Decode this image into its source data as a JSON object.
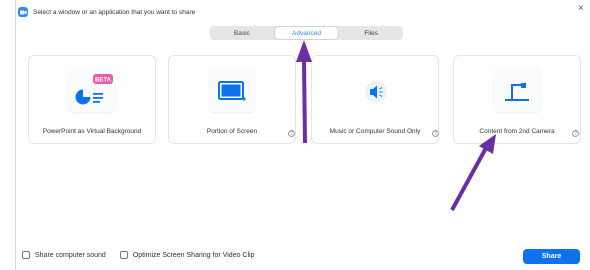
{
  "window": {
    "title": "Select a window or an application that you want to share",
    "close_glyph": "×"
  },
  "tabs": [
    {
      "label": "Basic",
      "active": false
    },
    {
      "label": "Advanced",
      "active": true
    },
    {
      "label": "Files",
      "active": false
    }
  ],
  "cards": [
    {
      "label": "PowerPoint as Virtual Background",
      "badge": "BETA",
      "icon": "powerpoint-icon",
      "has_help": false
    },
    {
      "label": "Portion of Screen",
      "icon": "screen-portion-icon",
      "has_help": true
    },
    {
      "label": "Music or Computer Sound Only",
      "icon": "speaker-icon",
      "has_help": true
    },
    {
      "label": "Content from 2nd Camera",
      "icon": "camera-icon",
      "has_help": true
    }
  ],
  "help_glyph": "?",
  "footer": {
    "share_sound_label": "Share computer sound",
    "optimize_label": "Optimize Screen Sharing for Video Clip",
    "share_button": "Share"
  },
  "colors": {
    "accent": "#2d8cff",
    "share_button": "#0e72ed",
    "badge": "#e85da7",
    "annotation_arrow": "#6a2fa0"
  }
}
